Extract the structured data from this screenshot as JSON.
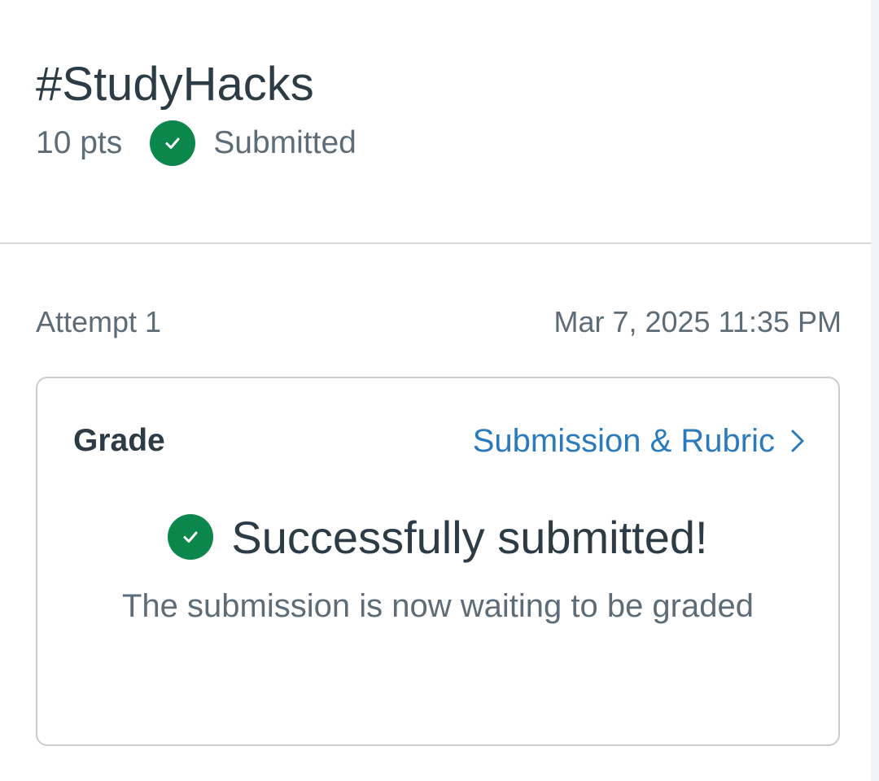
{
  "assignment": {
    "title": "#StudyHacks",
    "points": "10 pts",
    "status": "Submitted",
    "status_icon": "check-circle-icon",
    "status_color": "#0b874b"
  },
  "attempt": {
    "label": "Attempt 1",
    "timestamp": "Mar 7, 2025 11:35 PM"
  },
  "grade_card": {
    "heading": "Grade",
    "link_label": "Submission & Rubric",
    "link_icon": "chevron-right-icon",
    "link_color": "#2b7abc",
    "success_icon": "check-circle-icon",
    "success_title": "Successfully submitted!",
    "success_message": "The submission is now waiting to be graded"
  }
}
